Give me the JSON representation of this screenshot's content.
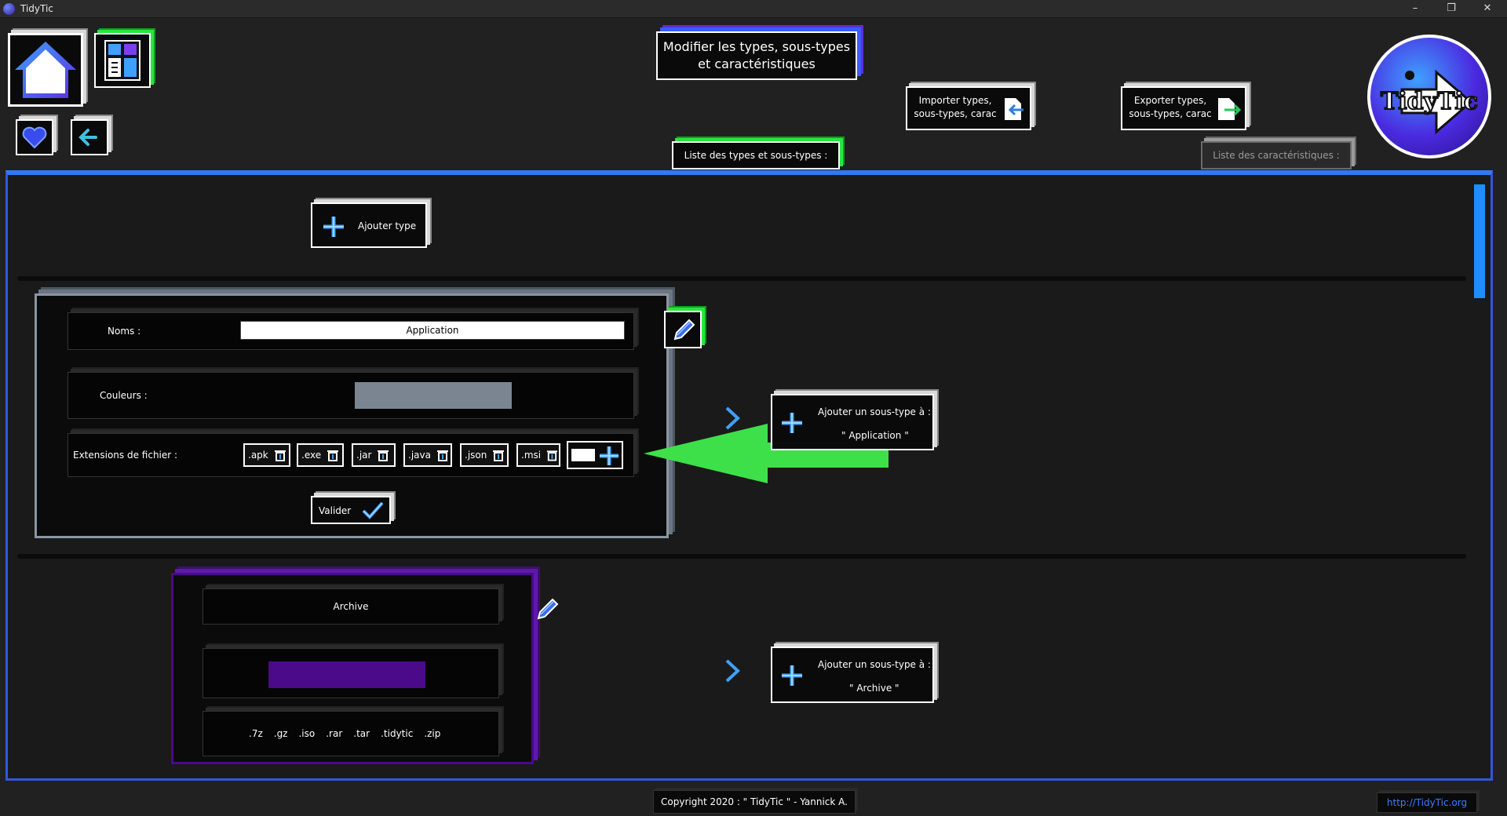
{
  "window": {
    "title": "TidyTic",
    "minimize": "–",
    "maximize": "❐",
    "close": "✕"
  },
  "header": {
    "title_line1": "Modifier les types, sous-types",
    "title_line2": "et caractéristiques",
    "import_line1": "Importer types,",
    "import_line2": "sous-types, carac",
    "export_line1": "Exporter types,",
    "export_line2": "sous-types, carac",
    "tab_types": "Liste des types et sous-types :",
    "tab_carac": "Liste des caractéristiques :",
    "logo_text": "TidyTic"
  },
  "main": {
    "add_type_label": "Ajouter type",
    "edit_type": {
      "name_label": "Noms :",
      "name_value": "Application",
      "color_label": "Couleurs :",
      "color_value": "#7b8591",
      "ext_label": "Extensions de fichier :",
      "extensions": [
        ".apk",
        ".exe",
        ".jar",
        ".java",
        ".json",
        ".msi"
      ],
      "validate_label": "Valider"
    },
    "add_subtype_app_line1": "Ajouter un sous-type à :",
    "add_subtype_app_line2": "\" Application \"",
    "archive_type": {
      "name": "Archive",
      "color_value": "#4a0a8a",
      "extensions": [
        ".7z",
        ".gz",
        ".iso",
        ".rar",
        ".tar",
        ".tidytic",
        ".zip"
      ]
    },
    "add_subtype_arch_line1": "Ajouter un sous-type à :",
    "add_subtype_arch_line2": "\" Archive \""
  },
  "footer": {
    "copyright": "Copyright 2020 : \" TidyTic \" - Yannick A.",
    "link": "http://TidyTic.org"
  },
  "colors": {
    "accent_blue": "#3478f0",
    "accent_green": "#27e63f",
    "accent_purple": "#5d1aa8"
  }
}
